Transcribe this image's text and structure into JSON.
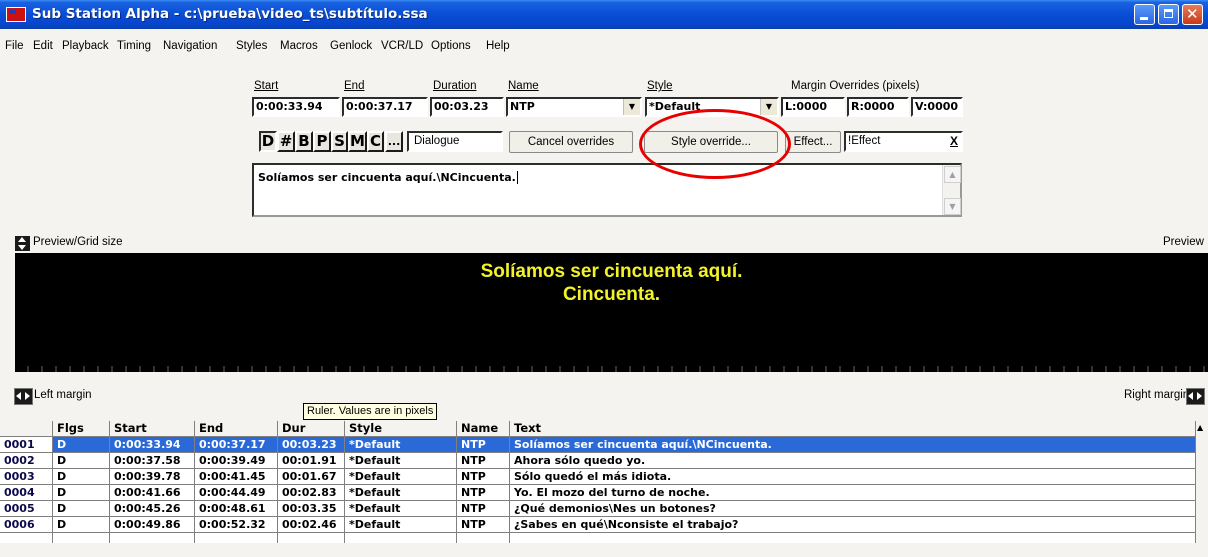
{
  "window": {
    "title": "Sub Station Alpha - c:\\prueba\\video_ts\\subtítulo.ssa"
  },
  "menu": [
    "File",
    "Edit",
    "Playback",
    "Timing",
    "Navigation",
    "Styles",
    "Macros",
    "Genlock",
    "VCR/LD",
    "Options",
    "Help"
  ],
  "editor": {
    "start_label": "Start",
    "end_label": "End",
    "duration_label": "Duration",
    "name_label": "Name",
    "style_label": "Style",
    "margin_label": "Margin Overrides (pixels)",
    "start": "0:00:33.94",
    "end": "0:00:37.17",
    "duration": "00:03.23",
    "name": "NTP",
    "style": "*Default",
    "margin_l": "L:0000",
    "margin_r": "R:0000",
    "margin_v": "V:0000",
    "flag_buttons": [
      "D",
      "#",
      "B",
      "P",
      "S",
      "M",
      "C",
      "..."
    ],
    "dialogue_label": "Dialogue",
    "cancel_overrides": "Cancel overrides",
    "style_override": "Style override...",
    "effect_button": "Effect...",
    "effect_value": "!Effect",
    "effect_clear": "X",
    "text": "Solíamos ser cincuenta aquí.\\NCincuenta."
  },
  "preview": {
    "left_label": "Preview/Grid size",
    "right_label": "Preview",
    "line1": "Solíamos ser cincuenta aquí.",
    "line2": "Cincuenta.",
    "left_margin_label": "Left margin",
    "right_margin_label": "Right margin",
    "ruler_tooltip": "Ruler. Values are in pixels"
  },
  "grid": {
    "columns": [
      "",
      "Flgs",
      "Start",
      "End",
      "Dur",
      "Style",
      "Name",
      "Text"
    ],
    "rows": [
      [
        "0001",
        "D",
        "0:00:33.94",
        "0:00:37.17",
        "00:03.23",
        "*Default",
        "NTP",
        "Solíamos ser cincuenta aquí.\\NCincuenta."
      ],
      [
        "0002",
        "D",
        "0:00:37.58",
        "0:00:39.49",
        "00:01.91",
        "*Default",
        "NTP",
        "Ahora sólo quedo yo."
      ],
      [
        "0003",
        "D",
        "0:00:39.78",
        "0:00:41.45",
        "00:01.67",
        "*Default",
        "NTP",
        "Sólo quedó el más idiota."
      ],
      [
        "0004",
        "D",
        "0:00:41.66",
        "0:00:44.49",
        "00:02.83",
        "*Default",
        "NTP",
        "Yo. El mozo del turno de noche."
      ],
      [
        "0005",
        "D",
        "0:00:45.26",
        "0:00:48.61",
        "00:03.35",
        "*Default",
        "NTP",
        "¿Qué demonios\\Nes un botones?"
      ],
      [
        "0006",
        "D",
        "0:00:49.86",
        "0:00:52.32",
        "00:02.46",
        "*Default",
        "NTP",
        "¿Sabes en qué\\Nconsiste el trabajo?"
      ]
    ],
    "selected_row": 0
  },
  "colors": {
    "title_bar": "#0a4fd7",
    "selection": "#2a6ad8",
    "subtitle_text": "#f2f22a",
    "highlight_circle": "#e80000"
  }
}
